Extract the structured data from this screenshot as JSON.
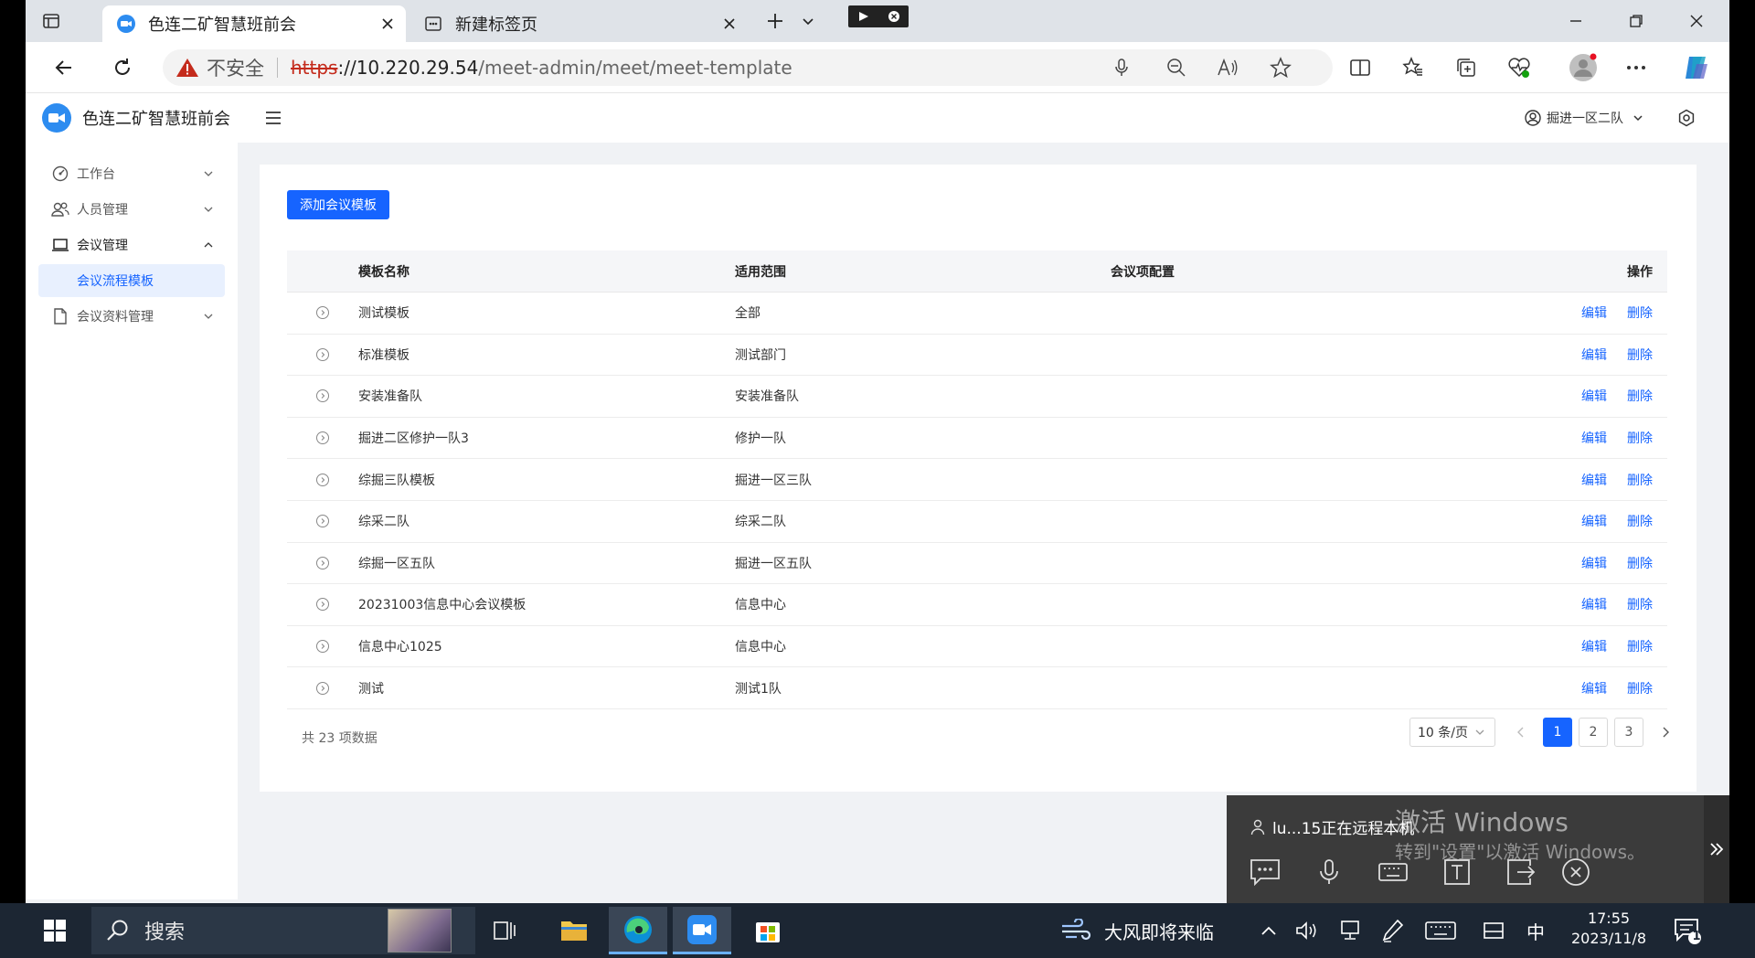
{
  "browser": {
    "tabs": [
      {
        "title": "色连二矿智慧班前会"
      },
      {
        "title": "新建标签页"
      }
    ],
    "address": {
      "security_label": "不安全",
      "scheme": "https",
      "host": "://10.220.29.54",
      "path": "/meet-admin/meet/meet-template"
    }
  },
  "app": {
    "title": "色连二矿智慧班前会",
    "user": "掘进一区二队"
  },
  "sidebar": {
    "items": [
      {
        "label": "工作台",
        "icon": "dashboard-icon"
      },
      {
        "label": "人员管理",
        "icon": "users-icon"
      },
      {
        "label": "会议管理",
        "icon": "laptop-icon"
      },
      {
        "label": "会议流程模板"
      },
      {
        "label": "会议资料管理",
        "icon": "file-icon"
      }
    ]
  },
  "main": {
    "add_button": "添加会议模板",
    "columns": [
      "模板名称",
      "适用范围",
      "会议项配置",
      "操作"
    ],
    "rows": [
      {
        "name": "测试模板",
        "scope": "全部",
        "edit": "编辑",
        "delete": "删除"
      },
      {
        "name": "标准模板",
        "scope": "测试部门",
        "edit": "编辑",
        "delete": "删除"
      },
      {
        "name": "安装准备队",
        "scope": "安装准备队",
        "edit": "编辑",
        "delete": "删除"
      },
      {
        "name": "掘进二区修护一队3",
        "scope": "修护一队",
        "edit": "编辑",
        "delete": "删除"
      },
      {
        "name": "综掘三队模板",
        "scope": "掘进一区三队",
        "edit": "编辑",
        "delete": "删除"
      },
      {
        "name": "综采二队",
        "scope": "综采二队",
        "edit": "编辑",
        "delete": "删除"
      },
      {
        "name": "综掘一区五队",
        "scope": "掘进一区五队",
        "edit": "编辑",
        "delete": "删除"
      },
      {
        "name": "20231003信息中心会议模板",
        "scope": "信息中心",
        "edit": "编辑",
        "delete": "删除"
      },
      {
        "name": "信息中心1025",
        "scope": "信息中心",
        "edit": "编辑",
        "delete": "删除"
      },
      {
        "name": "测试",
        "scope": "测试1队",
        "edit": "编辑",
        "delete": "删除"
      }
    ],
    "pagination": {
      "total_text": "共 23 项数据",
      "page_size": "10 条/页",
      "pages": [
        "1",
        "2",
        "3"
      ],
      "current": "1"
    }
  },
  "remote_overlay": {
    "status": "lu...15正在远程本机",
    "watermark_title": "激活 Windows",
    "watermark_sub": "转到\"设置\"以激活 Windows。"
  },
  "taskbar": {
    "search_label": "搜索",
    "weather": "大风即将来临",
    "ime": "中",
    "time": "17:55",
    "date": "2023/11/8",
    "notification_count": "1"
  },
  "colors": {
    "primary": "#1664ff",
    "taskbar": "#1c2633",
    "warning": "#c42b1c"
  }
}
